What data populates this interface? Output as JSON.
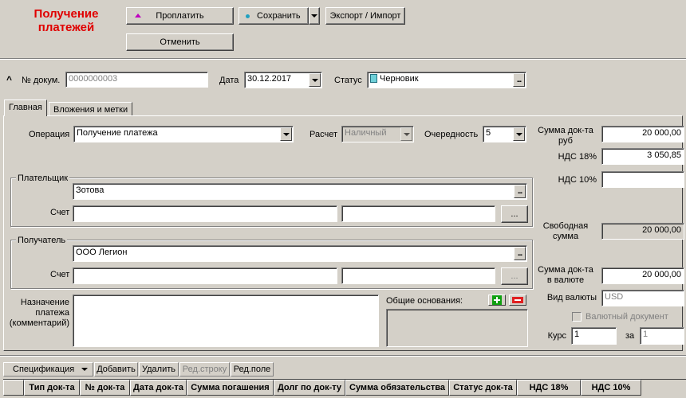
{
  "header": {
    "title": "Получение платежей",
    "pay_label": "Проплатить",
    "save_label": "Сохранить",
    "export_label": "Экспорт / Импорт",
    "cancel_label": "Отменить"
  },
  "doc": {
    "number_label": "№ докум.",
    "number_value": "0000000003",
    "date_label": "Дата",
    "date_value": "30.12.2017",
    "status_label": "Статус",
    "status_value": "Черновик"
  },
  "tabs": [
    {
      "label": "Главная",
      "active": true
    },
    {
      "label": "Вложения и метки",
      "active": false
    }
  ],
  "main": {
    "operation_label": "Операция",
    "operation_value": "Получение платежа",
    "calc_label": "Расчет",
    "calc_value": "Наличный",
    "priority_label": "Очередность",
    "priority_value": "5",
    "payer_group": "Плательщик",
    "payer_value": "Зотова",
    "account_label": "Счет",
    "payer_account1": "",
    "payer_account2": "",
    "payer_browse": "...",
    "recipient_group": "Получатель",
    "recipient_value": "ООО Легион",
    "recipient_account1": "",
    "recipient_account2": "",
    "recipient_browse": "...",
    "purpose_label": "Назначение платежа (комментарий)",
    "purpose_value": "",
    "basis_label": "Общие основания:"
  },
  "sums": {
    "sum_rub_label": "Сумма док-та руб",
    "sum_rub_value": "20 000,00",
    "vat18_label": "НДС 18%",
    "vat18_value": "3 050,85",
    "vat10_label": "НДС 10%",
    "vat10_value": "",
    "free_label": "Свободная сумма",
    "free_value": "20 000,00",
    "sum_cur_label": "Сумма док-та в валюте",
    "sum_cur_value": "20 000,00",
    "currency_label": "Вид валюты",
    "currency_value": "USD",
    "currency_doc_label": "Валютный документ",
    "rate_label": "Курс",
    "rate_value": "1",
    "per_label": "за",
    "per_value": "1"
  },
  "spec_toolbar": {
    "spec_label": "Спецификация",
    "add_label": "Добавить",
    "delete_label": "Удалить",
    "edit_row_label": "Ред.строку",
    "edit_field_label": "Ред.поле"
  },
  "grid": {
    "columns": [
      "",
      "Тип док-та",
      "№ док-та",
      "Дата док-та",
      "Сумма погашения",
      "Долг по док-ту",
      "Сумма обязательства",
      "Статус док-та",
      "НДС 18%",
      "НДС 10%"
    ]
  },
  "colors": {
    "title": "#e00000",
    "window_bg": "#d4d0c8"
  }
}
